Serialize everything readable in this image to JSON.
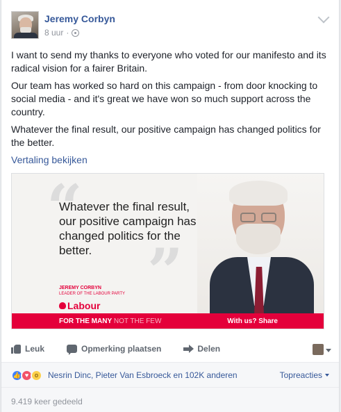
{
  "post": {
    "author": "Jeremy Corbyn",
    "time": "8 uur",
    "paragraphs": [
      "I want to send my thanks to everyone who voted for our manifesto and its radical vision for a fairer Britain.",
      "Our team has worked so hard on this campaign - from door knocking to social media - and it's great we have won so much support across the country.",
      "Whatever the final result, our positive campaign has changed politics for the better."
    ],
    "translate_link": "Vertaling bekijken"
  },
  "shared_image": {
    "quote": "Whatever the final result, our positive campaign has changed politics for the better.",
    "signature_name": "JEREMY CORBYN",
    "signature_title": "LEADER OF THE LABOUR PARTY",
    "logo_text": "Labour",
    "banner_left_bold": "FOR THE MANY",
    "banner_left_rest": "NOT THE FEW",
    "banner_right": "With us? Share",
    "brand_color": "#e4003b"
  },
  "actions": {
    "like": "Leuk",
    "comment": "Opmerking plaatsen",
    "share": "Delen"
  },
  "reactions": {
    "icons": [
      "like-icon",
      "love-icon",
      "wow-icon"
    ],
    "names": "Nesrin Dinc, Pieter Van Esbroeck en 102K anderen",
    "top": "Topreacties"
  },
  "shares": "9.419 keer gedeeld",
  "colors": {
    "link": "#365899",
    "meta": "#90949c",
    "action": "#606770"
  }
}
